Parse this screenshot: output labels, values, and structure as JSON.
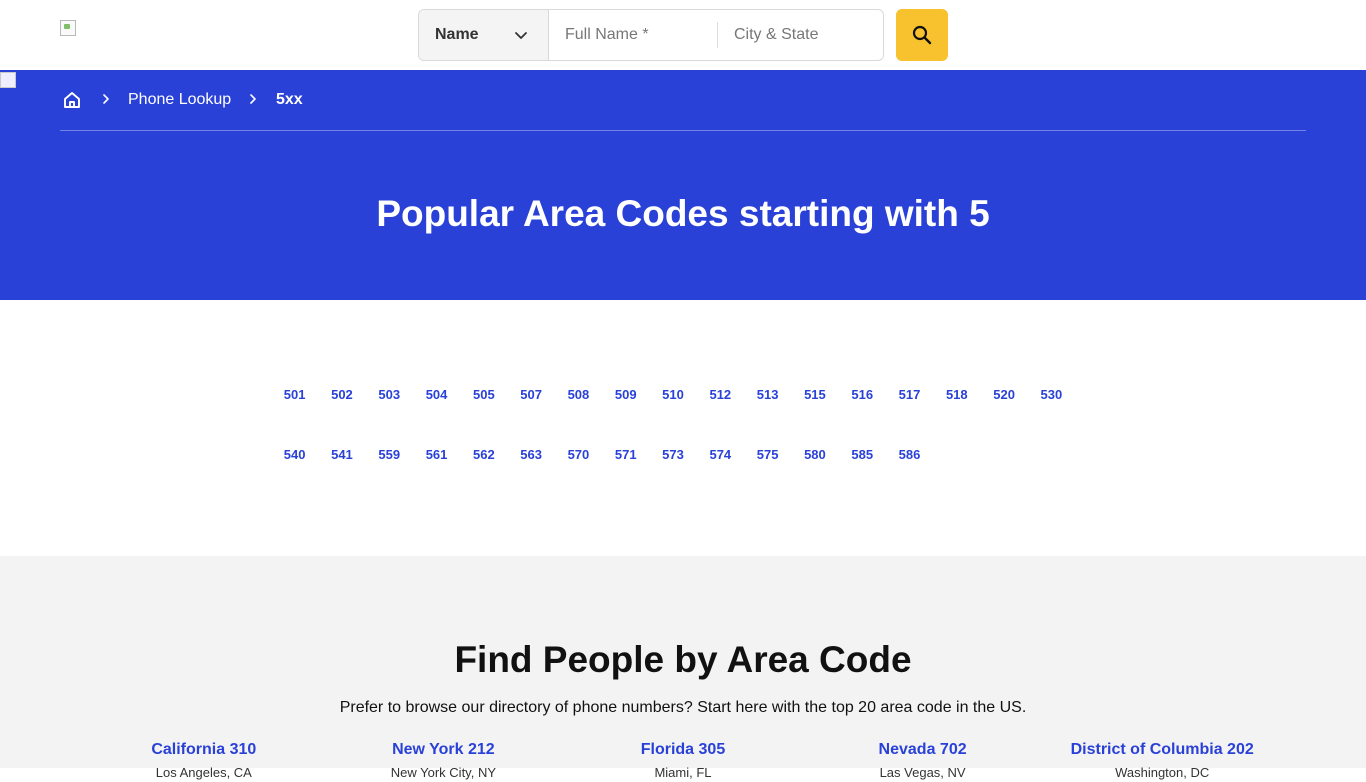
{
  "header": {
    "logo_icon": "broken-image-icon",
    "search": {
      "type_selected": "Name",
      "name_placeholder": "Full Name *",
      "city_placeholder": "City & State",
      "button_icon": "search-icon",
      "button_color": "#f8c22e"
    }
  },
  "hero": {
    "background_color": "#2a41d8",
    "breadcrumb": {
      "home_icon": "home-icon",
      "link": "Phone Lookup",
      "current": "5xx"
    },
    "title": "Popular Area Codes starting with 5"
  },
  "area_codes": [
    "501",
    "502",
    "503",
    "504",
    "505",
    "507",
    "508",
    "509",
    "510",
    "512",
    "513",
    "515",
    "516",
    "517",
    "518",
    "520",
    "530",
    "540",
    "541",
    "559",
    "561",
    "562",
    "563",
    "570",
    "571",
    "573",
    "574",
    "575",
    "580",
    "585",
    "586"
  ],
  "find_people": {
    "title": "Find People by Area Code",
    "subtitle": "Prefer to browse our directory of phone numbers? Start here with the top 20 area code in the US.",
    "columns": [
      {
        "label": "California 310",
        "city": "Los Angeles, CA"
      },
      {
        "label": "New York 212",
        "city": "New York City, NY"
      },
      {
        "label": "Florida 305",
        "city": "Miami, FL"
      },
      {
        "label": "Nevada 702",
        "city": "Las Vegas, NV"
      },
      {
        "label": "District of Columbia 202",
        "city": "Washington, DC"
      }
    ]
  }
}
